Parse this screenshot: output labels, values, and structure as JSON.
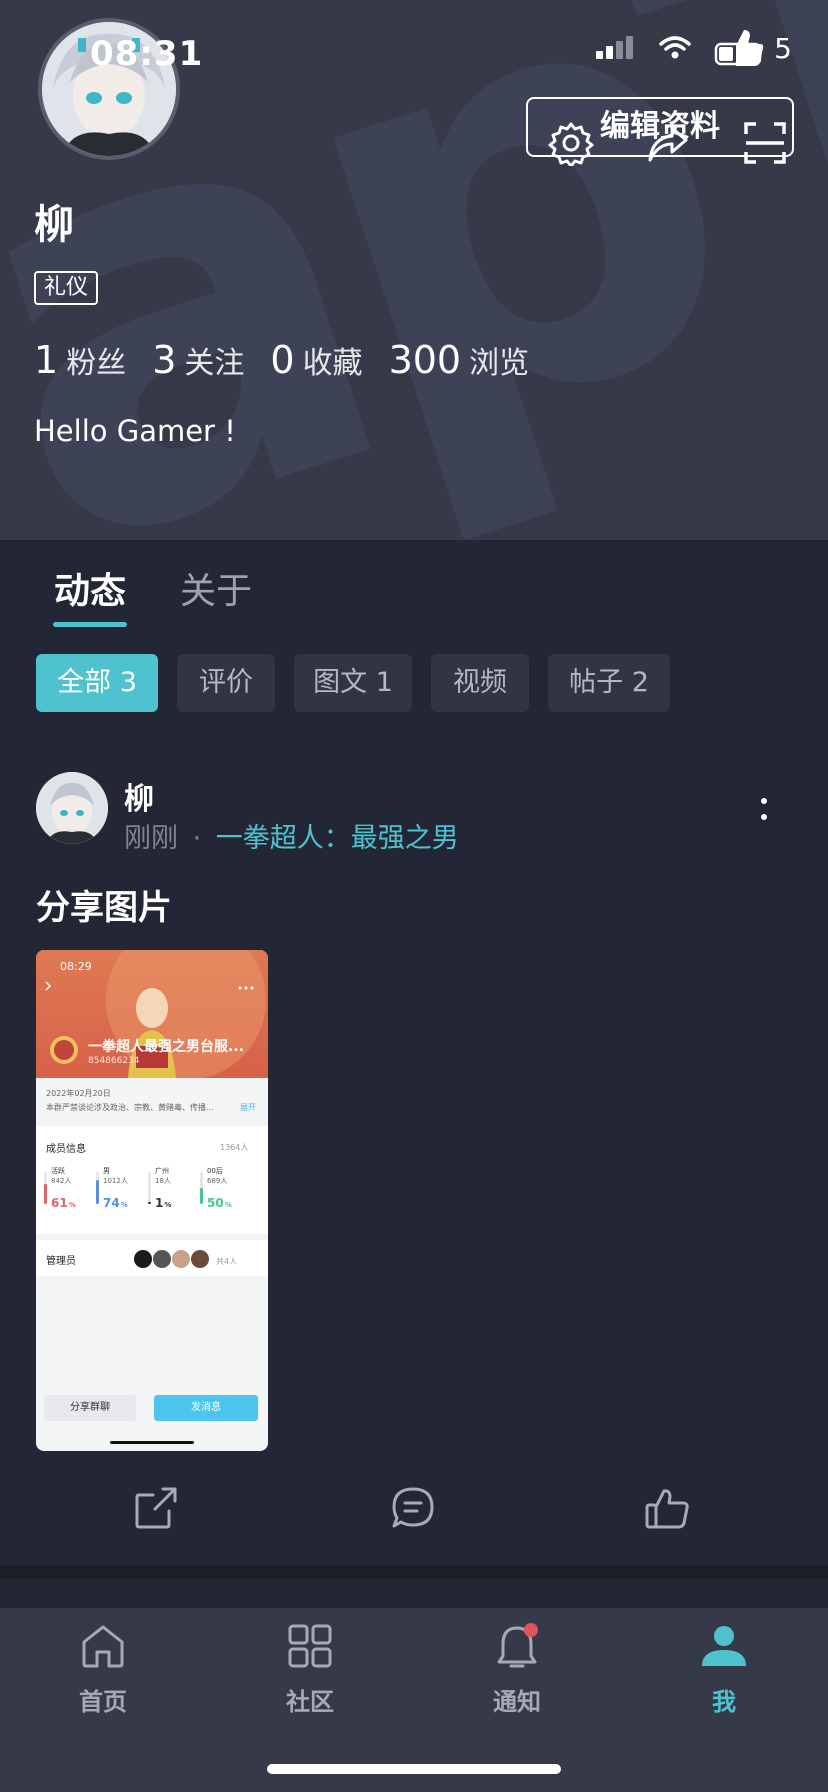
{
  "status_bar": {
    "time": "08:31",
    "like_count": "5"
  },
  "profile": {
    "name": "柳",
    "tag": "礼仪",
    "edit_button": "编辑资料",
    "stats": [
      {
        "num": "1",
        "label": "粉丝"
      },
      {
        "num": "3",
        "label": "关注"
      },
      {
        "num": "0",
        "label": "收藏"
      },
      {
        "num": "300",
        "label": "浏览"
      }
    ],
    "bio": "Hello Gamer !"
  },
  "tabs": [
    {
      "label": "动态",
      "active": true
    },
    {
      "label": "关于",
      "active": false
    }
  ],
  "filters": [
    {
      "label": "全部 3",
      "active": true
    },
    {
      "label": "评价",
      "active": false
    },
    {
      "label": "图文 1",
      "active": false
    },
    {
      "label": "视频",
      "active": false
    },
    {
      "label": "帖子 2",
      "active": false
    }
  ],
  "post": {
    "user": "柳",
    "time": "刚刚",
    "separator": "·",
    "game": "一拳超人：最强之男",
    "title": "分享图片",
    "image": {
      "time": "08:29",
      "group_name": "一拳超人最强之男台服...",
      "group_id": "854866234",
      "date": "2022年02月20日",
      "rule": "本群严禁谈论涉及政治、宗教、黄赌毒、传播...",
      "expand": "展开",
      "members_title": "成员信息",
      "members_count": "1364人",
      "bars": [
        {
          "label": "活跃",
          "count": "842人",
          "pct": "61",
          "color": "#e0626a"
        },
        {
          "label": "男",
          "count": "1012人",
          "pct": "74",
          "color": "#5a8fe0"
        },
        {
          "label": "广州",
          "count": "18人",
          "pct": "1",
          "color": "#333333"
        },
        {
          "label": "00后",
          "count": "689人",
          "pct": "50",
          "color": "#4cc38a"
        }
      ],
      "admins_title": "管理员",
      "admins_count": "共4人",
      "share_btn": "分享群聊",
      "send_btn": "发消息"
    }
  },
  "bottom_nav": [
    {
      "label": "首页",
      "icon": "home-icon",
      "active": false
    },
    {
      "label": "社区",
      "icon": "grid-icon",
      "active": false
    },
    {
      "label": "通知",
      "icon": "bell-icon",
      "active": false
    },
    {
      "label": "我",
      "icon": "person-icon",
      "active": true
    }
  ],
  "colors": {
    "accent": "#4ec3cf",
    "header_bg": "#363a48",
    "page_bg": "#232634",
    "badge": "#e0555a"
  }
}
